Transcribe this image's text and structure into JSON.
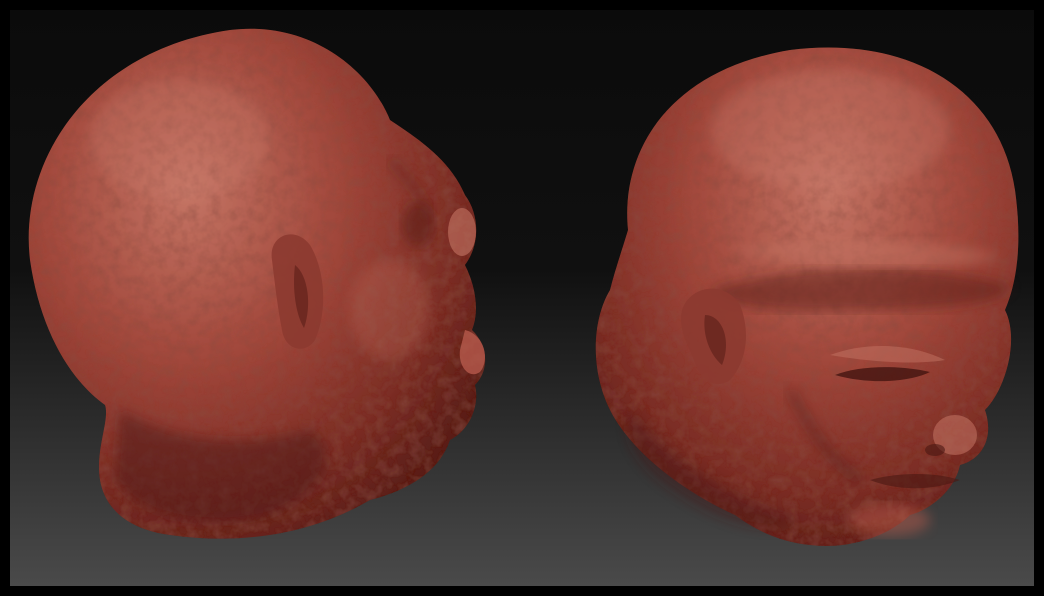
{
  "scene": {
    "frame_color": "#000000",
    "background_top": "#0b0b0b",
    "background_bottom": "#4a4a4a",
    "clay_color": "#a0463a",
    "clay_highlight": "#c47464",
    "clay_shadow": "#5a1e18"
  },
  "models": [
    {
      "name": "sculpted-head-profile-view"
    },
    {
      "name": "sculpted-head-three-quarter-view"
    }
  ]
}
